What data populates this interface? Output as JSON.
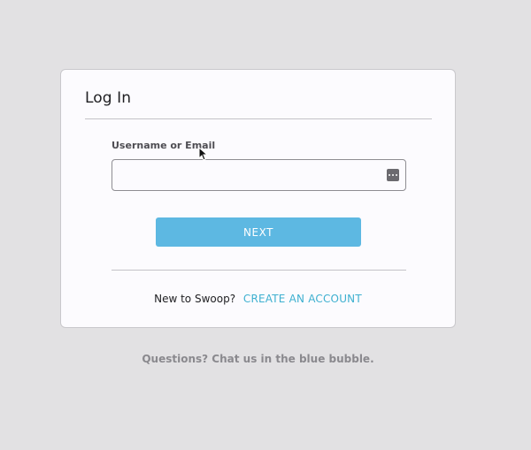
{
  "login": {
    "title": "Log In",
    "field_label": "Username or Email",
    "field_value": "",
    "field_placeholder": "",
    "next_label": "NEXT",
    "new_user_prompt": "New to Swoop?",
    "create_account_label": "CREATE AN ACCOUNT"
  },
  "footer": {
    "help_text": "Questions? Chat us in the blue bubble."
  },
  "icons": {
    "password_manager": "password-manager-icon",
    "cursor": "mouse-pointer-icon"
  },
  "colors": {
    "background": "#e2e1e3",
    "card": "#fcfbfe",
    "primary_button": "#5db8e2",
    "link": "#3eb0d0",
    "help_text": "#8a898e"
  }
}
